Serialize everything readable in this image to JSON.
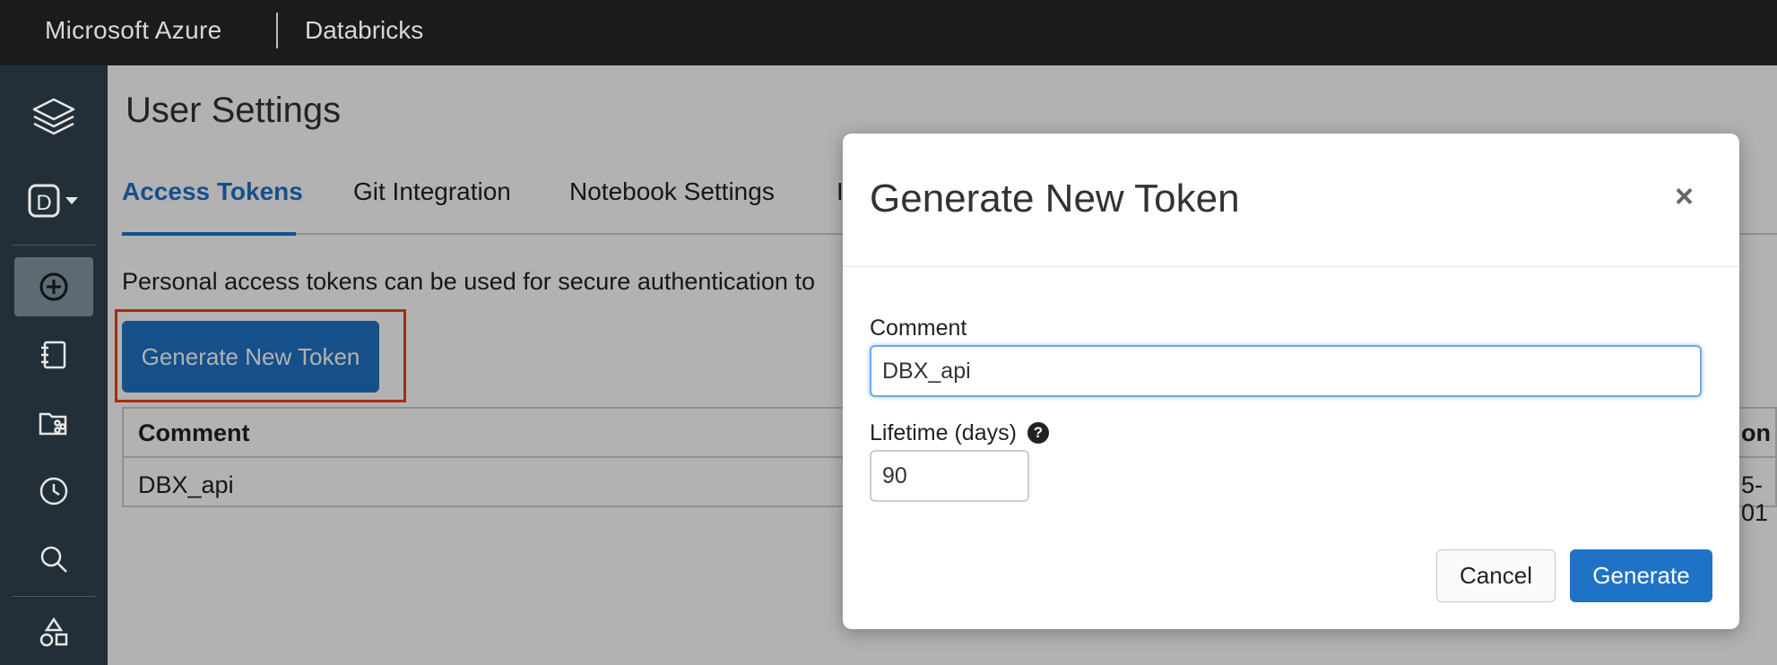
{
  "topbar": {
    "brand": "Microsoft Azure",
    "product": "Databricks"
  },
  "sidebar": {
    "workspace_badge": "D"
  },
  "page": {
    "title": "User Settings",
    "tabs": [
      {
        "label": "Access Tokens",
        "active": true
      },
      {
        "label": "Git Integration",
        "active": false
      },
      {
        "label": "Notebook Settings",
        "active": false
      },
      {
        "label": "I",
        "active": false
      }
    ],
    "description": "Personal access tokens can be used for secure authentication to",
    "generate_button": "Generate New Token",
    "table": {
      "headers": [
        "Comment",
        "on"
      ],
      "rows": [
        {
          "comment": "DBX_api",
          "date": "5-01"
        }
      ]
    }
  },
  "modal": {
    "title": "Generate New Token",
    "close_symbol": "×",
    "comment_label": "Comment",
    "comment_value": "DBX_api",
    "lifetime_label": "Lifetime (days)",
    "lifetime_value": "90",
    "help_symbol": "?",
    "cancel_label": "Cancel",
    "generate_label": "Generate"
  },
  "colors": {
    "accent": "#1f73c6",
    "highlight": "#e8431f",
    "topbar": "#1b1b1b",
    "sidebar": "#222f38"
  }
}
